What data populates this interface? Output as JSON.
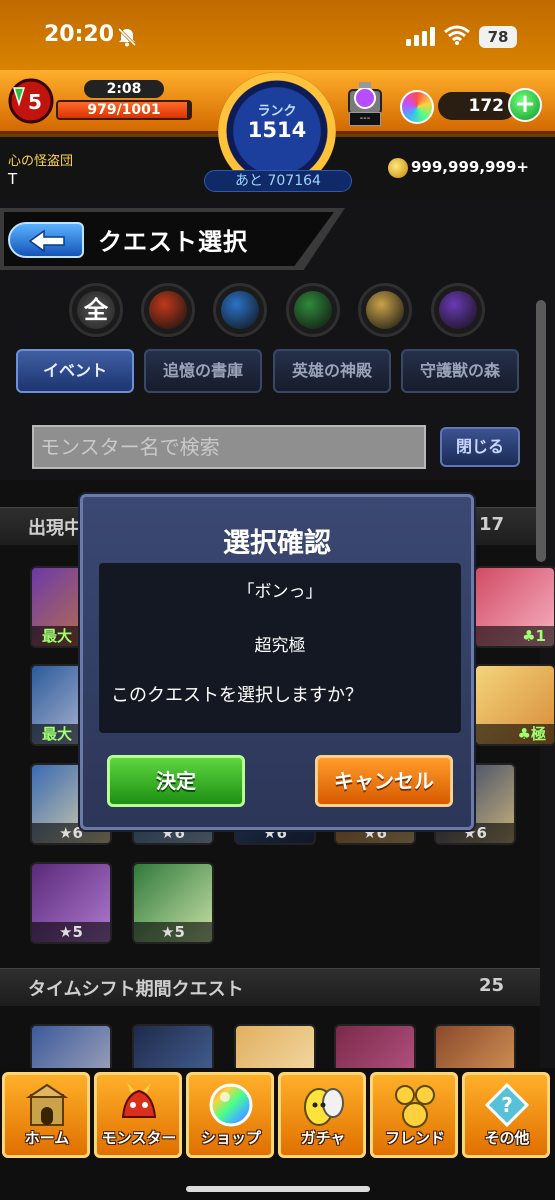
{
  "statusbar": {
    "time": "20:20",
    "battery": "78"
  },
  "hud": {
    "stamina_timer": "2:08",
    "stamina_value": "979/1001",
    "stamina_fraction": 0.978,
    "rank_label": "ランク",
    "rank": "1514",
    "rank_next": "あと 707164",
    "orb_machine_screen": "---",
    "orbs": "172",
    "guild": "心の怪盗団",
    "player_name": "T",
    "gold": "999,999,999+"
  },
  "header": {
    "title": "クエスト選択"
  },
  "elements": [
    {
      "name": "all",
      "label": "全",
      "color": "#555555"
    },
    {
      "name": "fire",
      "color": "#c0391b"
    },
    {
      "name": "water",
      "color": "#2a73c9"
    },
    {
      "name": "wood",
      "color": "#2f8a3b"
    },
    {
      "name": "light",
      "color": "#c9a34a"
    },
    {
      "name": "dark",
      "color": "#6a3ab5"
    }
  ],
  "categories": [
    "イベント",
    "追憶の書庫",
    "英雄の神殿",
    "守護獣の森"
  ],
  "search": {
    "placeholder": "モンスター名で検索",
    "close_label": "閉じる"
  },
  "sections": [
    {
      "title": "出現中",
      "count": "17"
    },
    {
      "title": "タイムシフト期間クエスト",
      "count": "25"
    }
  ],
  "tile_stars": [
    "★6",
    "★6",
    "★6",
    "★6",
    "★6",
    "★5",
    "★5"
  ],
  "badges": {
    "max": "最大",
    "club1": "♣1",
    "club_kyoku": "♣極"
  },
  "dialog": {
    "title": "選択確認",
    "quest_name": "「ボンっ」",
    "difficulty": "超究極",
    "question": "このクエストを選択しますか？",
    "ok_label": "決定",
    "cancel_label": "キャンセル"
  },
  "nav": [
    {
      "label": "ホーム",
      "icon": "castle-icon"
    },
    {
      "label": "モンスター",
      "icon": "dragon-icon"
    },
    {
      "label": "ショップ",
      "icon": "orb-icon"
    },
    {
      "label": "ガチャ",
      "icon": "egg-icon"
    },
    {
      "label": "フレンド",
      "icon": "friends-icon"
    },
    {
      "label": "その他",
      "icon": "menu-icon"
    }
  ]
}
